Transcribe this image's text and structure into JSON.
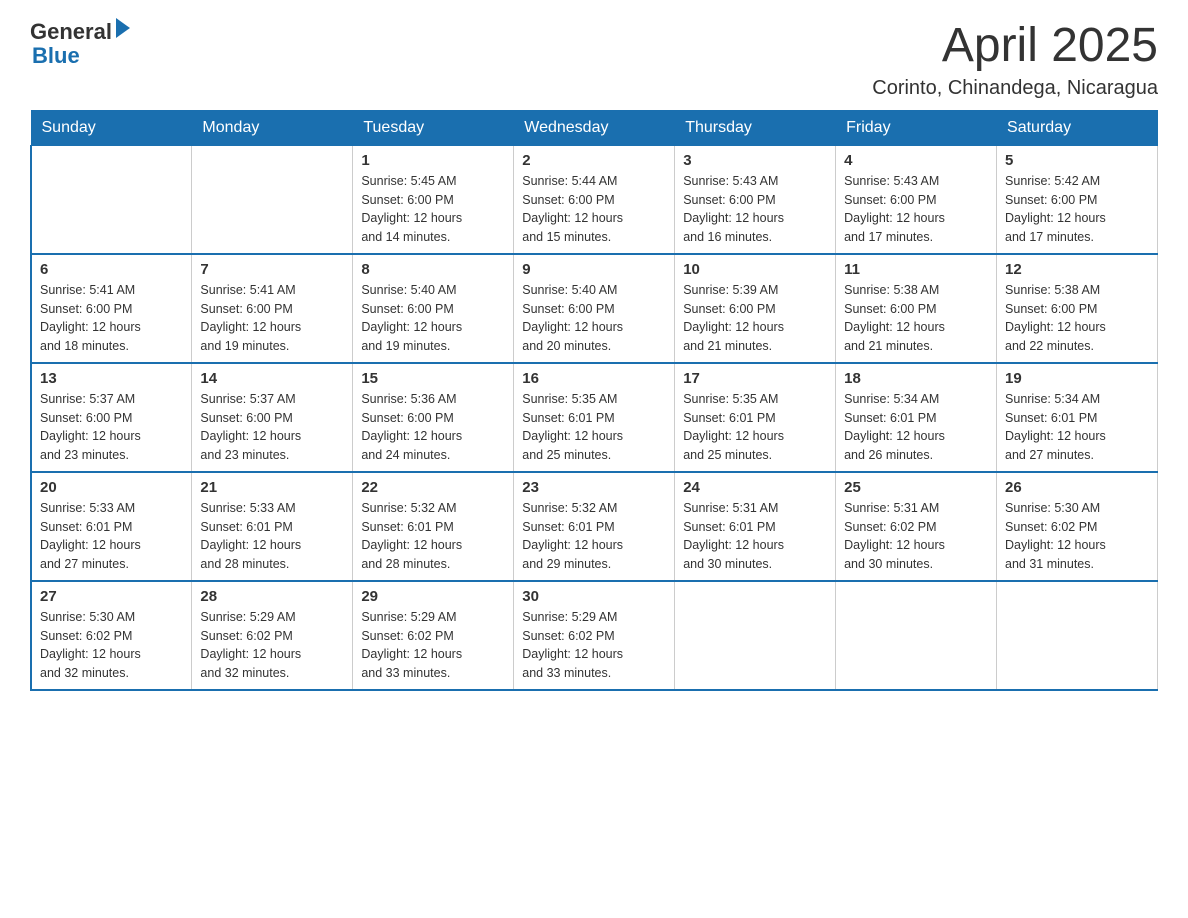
{
  "header": {
    "logo_text1": "General",
    "logo_text2": "Blue",
    "title": "April 2025",
    "subtitle": "Corinto, Chinandega, Nicaragua"
  },
  "weekdays": [
    "Sunday",
    "Monday",
    "Tuesday",
    "Wednesday",
    "Thursday",
    "Friday",
    "Saturday"
  ],
  "weeks": [
    [
      {
        "num": "",
        "info": ""
      },
      {
        "num": "",
        "info": ""
      },
      {
        "num": "1",
        "info": "Sunrise: 5:45 AM\nSunset: 6:00 PM\nDaylight: 12 hours\nand 14 minutes."
      },
      {
        "num": "2",
        "info": "Sunrise: 5:44 AM\nSunset: 6:00 PM\nDaylight: 12 hours\nand 15 minutes."
      },
      {
        "num": "3",
        "info": "Sunrise: 5:43 AM\nSunset: 6:00 PM\nDaylight: 12 hours\nand 16 minutes."
      },
      {
        "num": "4",
        "info": "Sunrise: 5:43 AM\nSunset: 6:00 PM\nDaylight: 12 hours\nand 17 minutes."
      },
      {
        "num": "5",
        "info": "Sunrise: 5:42 AM\nSunset: 6:00 PM\nDaylight: 12 hours\nand 17 minutes."
      }
    ],
    [
      {
        "num": "6",
        "info": "Sunrise: 5:41 AM\nSunset: 6:00 PM\nDaylight: 12 hours\nand 18 minutes."
      },
      {
        "num": "7",
        "info": "Sunrise: 5:41 AM\nSunset: 6:00 PM\nDaylight: 12 hours\nand 19 minutes."
      },
      {
        "num": "8",
        "info": "Sunrise: 5:40 AM\nSunset: 6:00 PM\nDaylight: 12 hours\nand 19 minutes."
      },
      {
        "num": "9",
        "info": "Sunrise: 5:40 AM\nSunset: 6:00 PM\nDaylight: 12 hours\nand 20 minutes."
      },
      {
        "num": "10",
        "info": "Sunrise: 5:39 AM\nSunset: 6:00 PM\nDaylight: 12 hours\nand 21 minutes."
      },
      {
        "num": "11",
        "info": "Sunrise: 5:38 AM\nSunset: 6:00 PM\nDaylight: 12 hours\nand 21 minutes."
      },
      {
        "num": "12",
        "info": "Sunrise: 5:38 AM\nSunset: 6:00 PM\nDaylight: 12 hours\nand 22 minutes."
      }
    ],
    [
      {
        "num": "13",
        "info": "Sunrise: 5:37 AM\nSunset: 6:00 PM\nDaylight: 12 hours\nand 23 minutes."
      },
      {
        "num": "14",
        "info": "Sunrise: 5:37 AM\nSunset: 6:00 PM\nDaylight: 12 hours\nand 23 minutes."
      },
      {
        "num": "15",
        "info": "Sunrise: 5:36 AM\nSunset: 6:00 PM\nDaylight: 12 hours\nand 24 minutes."
      },
      {
        "num": "16",
        "info": "Sunrise: 5:35 AM\nSunset: 6:01 PM\nDaylight: 12 hours\nand 25 minutes."
      },
      {
        "num": "17",
        "info": "Sunrise: 5:35 AM\nSunset: 6:01 PM\nDaylight: 12 hours\nand 25 minutes."
      },
      {
        "num": "18",
        "info": "Sunrise: 5:34 AM\nSunset: 6:01 PM\nDaylight: 12 hours\nand 26 minutes."
      },
      {
        "num": "19",
        "info": "Sunrise: 5:34 AM\nSunset: 6:01 PM\nDaylight: 12 hours\nand 27 minutes."
      }
    ],
    [
      {
        "num": "20",
        "info": "Sunrise: 5:33 AM\nSunset: 6:01 PM\nDaylight: 12 hours\nand 27 minutes."
      },
      {
        "num": "21",
        "info": "Sunrise: 5:33 AM\nSunset: 6:01 PM\nDaylight: 12 hours\nand 28 minutes."
      },
      {
        "num": "22",
        "info": "Sunrise: 5:32 AM\nSunset: 6:01 PM\nDaylight: 12 hours\nand 28 minutes."
      },
      {
        "num": "23",
        "info": "Sunrise: 5:32 AM\nSunset: 6:01 PM\nDaylight: 12 hours\nand 29 minutes."
      },
      {
        "num": "24",
        "info": "Sunrise: 5:31 AM\nSunset: 6:01 PM\nDaylight: 12 hours\nand 30 minutes."
      },
      {
        "num": "25",
        "info": "Sunrise: 5:31 AM\nSunset: 6:02 PM\nDaylight: 12 hours\nand 30 minutes."
      },
      {
        "num": "26",
        "info": "Sunrise: 5:30 AM\nSunset: 6:02 PM\nDaylight: 12 hours\nand 31 minutes."
      }
    ],
    [
      {
        "num": "27",
        "info": "Sunrise: 5:30 AM\nSunset: 6:02 PM\nDaylight: 12 hours\nand 32 minutes."
      },
      {
        "num": "28",
        "info": "Sunrise: 5:29 AM\nSunset: 6:02 PM\nDaylight: 12 hours\nand 32 minutes."
      },
      {
        "num": "29",
        "info": "Sunrise: 5:29 AM\nSunset: 6:02 PM\nDaylight: 12 hours\nand 33 minutes."
      },
      {
        "num": "30",
        "info": "Sunrise: 5:29 AM\nSunset: 6:02 PM\nDaylight: 12 hours\nand 33 minutes."
      },
      {
        "num": "",
        "info": ""
      },
      {
        "num": "",
        "info": ""
      },
      {
        "num": "",
        "info": ""
      }
    ]
  ]
}
